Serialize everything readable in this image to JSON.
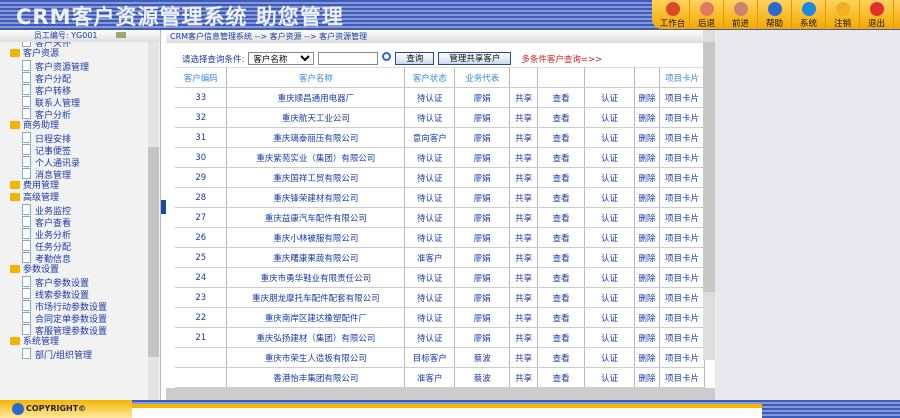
{
  "header": {
    "title": "CRM客户资源管理系统  助您管理"
  },
  "toolbar": [
    {
      "label": "工作台",
      "icon": "home-icon",
      "color": "#d94a2a"
    },
    {
      "label": "后退",
      "icon": "back-icon",
      "color": "#e07a60"
    },
    {
      "label": "前进",
      "icon": "forward-icon",
      "color": "#d08070"
    },
    {
      "label": "帮助",
      "icon": "help-icon",
      "color": "#2a6ad0"
    },
    {
      "label": "系统",
      "icon": "gear-icon",
      "color": "#1a8ae0"
    },
    {
      "label": "注销",
      "icon": "logout-icon",
      "color": "#f0b020"
    },
    {
      "label": "退出",
      "icon": "power-icon",
      "color": "#e03030"
    }
  ],
  "sidebar": {
    "employee": "员工编号: YG001",
    "tree": [
      {
        "t": "c",
        "l": "客户关怀"
      },
      {
        "t": "f",
        "l": "客户资源"
      },
      {
        "t": "c",
        "l": "客户资源管理"
      },
      {
        "t": "c",
        "l": "客户分配"
      },
      {
        "t": "c",
        "l": "客户转移"
      },
      {
        "t": "c",
        "l": "联系人管理"
      },
      {
        "t": "c",
        "l": "客户分析"
      },
      {
        "t": "f",
        "l": "商务助理"
      },
      {
        "t": "c",
        "l": "日程安排"
      },
      {
        "t": "c",
        "l": "记事便签"
      },
      {
        "t": "c",
        "l": "个人通讯录"
      },
      {
        "t": "c",
        "l": "消息管理"
      },
      {
        "t": "f",
        "l": "费用管理"
      },
      {
        "t": "f",
        "l": "高级管理"
      },
      {
        "t": "c",
        "l": "业务监控"
      },
      {
        "t": "c",
        "l": "客户查看"
      },
      {
        "t": "c",
        "l": "业务分析"
      },
      {
        "t": "c",
        "l": "任务分配"
      },
      {
        "t": "c",
        "l": "考勤信息"
      },
      {
        "t": "f",
        "l": "参数设置"
      },
      {
        "t": "c",
        "l": "客户参数设置"
      },
      {
        "t": "c",
        "l": "线索参数设置"
      },
      {
        "t": "c",
        "l": "市场行动参数设置"
      },
      {
        "t": "c",
        "l": "合同定单参数设置"
      },
      {
        "t": "c",
        "l": "客服管理参数设置"
      },
      {
        "t": "f",
        "l": "系统管理"
      },
      {
        "t": "c",
        "l": "部门/组织管理"
      }
    ],
    "copyright": "COPYRIGHT©"
  },
  "breadcrumb": "CRM客户信息管理系统 --> 客户资源 --> 客户资源管理",
  "query": {
    "label": "请选择查询条件:",
    "select": "客户名称",
    "input": "",
    "search": "查询",
    "manage": "管理共享客户",
    "multi": "多条件客户查询=>>"
  },
  "table": {
    "headers": [
      "客户编码",
      "客户名称",
      "客户状态",
      "业务代表",
      "",
      "",
      "",
      "",
      "项目卡片"
    ],
    "rows": [
      [
        "33",
        "重庆顺昌通用电器厂",
        "待认证",
        "廖娟"
      ],
      [
        "32",
        "重庆航天工业公司",
        "待认证",
        "廖娟"
      ],
      [
        "31",
        "重庆璃泰丽压有限公司",
        "意向客户",
        "廖娟"
      ],
      [
        "30",
        "重庆紫苑实业（集团）有限公司",
        "待认证",
        "廖娟"
      ],
      [
        "29",
        "重庆国祥工贸有限公司",
        "待认证",
        "廖娟"
      ],
      [
        "28",
        "重庆锋荣建材有限公司",
        "待认证",
        "廖娟"
      ],
      [
        "27",
        "重庆益康汽车配件有限公司",
        "待认证",
        "廖娟"
      ],
      [
        "26",
        "重庆小林被服有限公司",
        "待认证",
        "廖娟"
      ],
      [
        "25",
        "重庆曙康果蔬有限公司",
        "准客户",
        "廖娟"
      ],
      [
        "24",
        "重庆市勇华鞋业有限责任公司",
        "待认证",
        "廖娟"
      ],
      [
        "23",
        "重庆朋龙摩托车配件配套有限公司",
        "待认证",
        "廖娟"
      ],
      [
        "22",
        "重庆南岸区建达橡塑配件厂",
        "待认证",
        "廖娟"
      ],
      [
        "21",
        "重庆弘扬建材（集团）有限公司",
        "待认证",
        "廖娟"
      ],
      [
        "",
        "重庆市荣生人造板有限公司",
        "目标客户",
        "蔡波"
      ],
      [
        "",
        "香港怡丰集团有限公司",
        "准客户",
        "蔡波"
      ]
    ],
    "actions": [
      "共享",
      "查看",
      "认证",
      "删除",
      "项目卡片"
    ]
  }
}
